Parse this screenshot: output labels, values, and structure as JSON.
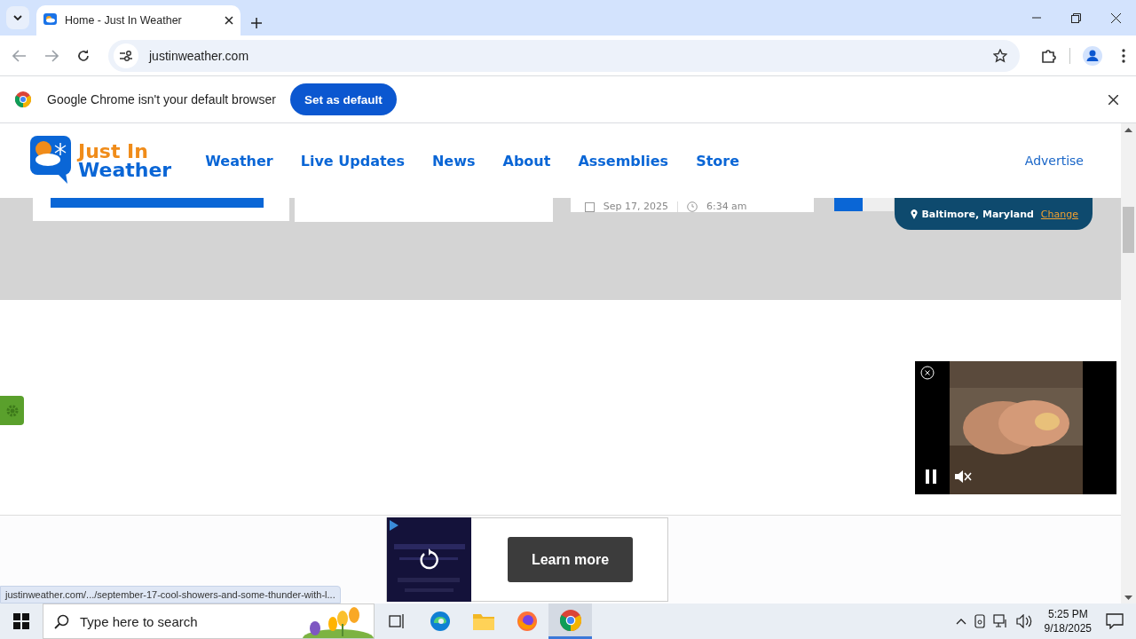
{
  "browser": {
    "tab_title": "Home - Just In Weather",
    "url": "justinweather.com",
    "infobar": {
      "message": "Google Chrome isn't your default browser",
      "button": "Set as default"
    }
  },
  "site": {
    "logo": {
      "line_1": "Just In",
      "line_2": "Weather"
    },
    "nav": [
      {
        "label": "Weather"
      },
      {
        "label": "Live Updates"
      },
      {
        "label": "News"
      },
      {
        "label": "About"
      },
      {
        "label": "Assemblies"
      },
      {
        "label": "Store"
      }
    ],
    "advertise": "Advertise"
  },
  "hero": {
    "date": "Sep 17, 2025",
    "time": "6:34 am",
    "location": "Baltimore, Maryland",
    "change": "Change"
  },
  "bottom_ad": {
    "button": "Learn more"
  },
  "status_url": "justinweather.com/.../september-17-cool-showers-and-some-thunder-with-l...",
  "taskbar": {
    "search_placeholder": "Type here to search",
    "time": "5:25 PM",
    "date": "9/18/2025"
  }
}
